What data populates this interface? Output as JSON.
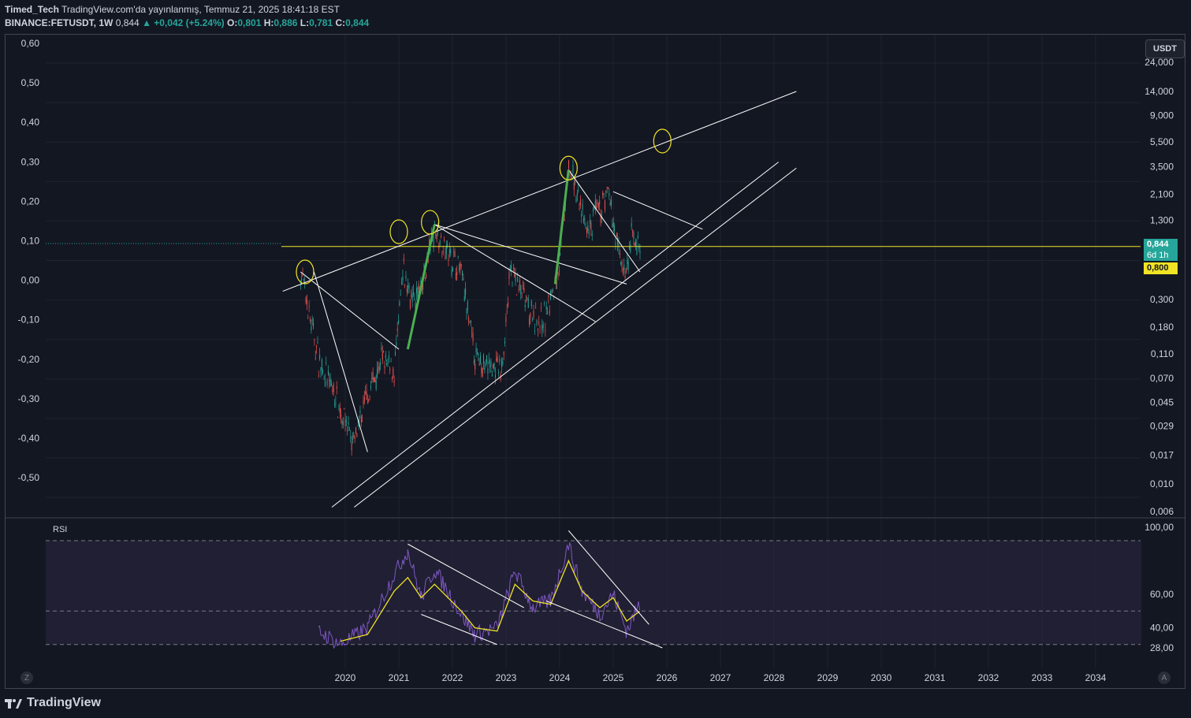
{
  "header": {
    "line1_author": "Timed_Tech",
    "line1_rest": "TradingView.com'da yayınlanmış, Temmuz 21, 2025 18:41:18 EST",
    "symbol": "BINANCE:FETUSDT, 1W",
    "last": "0,844",
    "change": "▲ +0,042 (+5.24%)",
    "o_label": "O:",
    "o_val": "0,801",
    "h_label": "H:",
    "h_val": "0,886",
    "l_label": "L:",
    "l_val": "0,781",
    "c_label": "C:",
    "c_val": "0,844"
  },
  "price_axis": {
    "currency": "USDT",
    "price_badge": "0,844",
    "countdown": "6d 1h",
    "level_badge": "0,800"
  },
  "rsi_label": "RSI",
  "corner_left": "Z",
  "corner_right": "A",
  "brand": "TradingView",
  "colors": {
    "up": "#26a69a",
    "down": "#ef5350",
    "background": "#131722",
    "drawing": "#ffffff",
    "highlight": "#f0e424",
    "green_leg": "#4caf50",
    "rsi_line": "#7e57c2",
    "rsi_ma": "#f0e424",
    "rsi_band": "#2a2540"
  },
  "chart_data": [
    {
      "type": "line",
      "scale": "log",
      "series": [
        {
          "x": [
            "2019-03",
            "2019-07",
            "2019-12",
            "2020-03",
            "2020-06",
            "2020-09",
            "2020-12",
            "2021-02",
            "2021-04",
            "2021-06",
            "2021-09",
            "2021-12",
            "2022-03",
            "2022-06",
            "2022-09",
            "2022-12",
            "2023-02",
            "2023-05",
            "2023-08",
            "2023-10",
            "2024-01",
            "2024-03",
            "2024-05",
            "2024-07",
            "2024-09",
            "2024-12",
            "2025-02",
            "2025-04",
            "2025-05",
            "2025-07"
          ],
          "y": [
            0.5,
            0.1,
            0.04,
            0.02,
            0.05,
            0.1,
            0.08,
            0.5,
            0.3,
            0.35,
            1.15,
            0.7,
            0.5,
            0.1,
            0.09,
            0.08,
            0.5,
            0.3,
            0.2,
            0.22,
            0.6,
            3.3,
            2.2,
            1.0,
            1.4,
            2.0,
            0.8,
            0.45,
            0.95,
            0.844
          ]
        }
      ],
      "y_ticks_left": [
        "0,60",
        "0,50",
        "0,40",
        "0,30",
        "0,20",
        "0,10",
        "0,00",
        "-0,10",
        "-0,20",
        "-0,30",
        "-0,40",
        "-0,50"
      ],
      "y_ticks_right": [
        "24,000",
        "14,000",
        "9,000",
        "5,500",
        "3,500",
        "2,100",
        "1,300",
        "0,300",
        "0,180",
        "0,110",
        "0,070",
        "0,045",
        "0,029",
        "0,017",
        "0,010",
        "0,006"
      ],
      "x_ticks": [
        "2020",
        "2021",
        "2022",
        "2023",
        "2024",
        "2025",
        "2026",
        "2027",
        "2028",
        "2029",
        "2030",
        "2031",
        "2032",
        "2033",
        "2034"
      ],
      "annotations": [
        "ascending channel",
        "upper resistance trendline",
        "descending triangles",
        "circled swing highs"
      ]
    },
    {
      "type": "line",
      "title": "RSI",
      "y_ticks": [
        "100,00",
        "60,00",
        "40,00",
        "28,00"
      ],
      "bands": [
        30,
        50,
        70
      ],
      "series": [
        {
          "name": "RSI",
          "x": [
            "2019-07",
            "2019-12",
            "2020-06",
            "2020-12",
            "2021-03",
            "2021-06",
            "2021-09",
            "2022-03",
            "2022-06",
            "2022-11",
            "2023-03",
            "2023-07",
            "2023-11",
            "2024-03",
            "2024-06",
            "2024-10",
            "2025-01",
            "2025-04",
            "2025-07"
          ],
          "values": [
            38,
            30,
            40,
            72,
            86,
            58,
            75,
            48,
            36,
            40,
            74,
            52,
            56,
            90,
            62,
            48,
            60,
            38,
            55
          ]
        },
        {
          "name": "MA",
          "x": [
            "2019-12",
            "2020-06",
            "2020-12",
            "2021-03",
            "2021-06",
            "2021-09",
            "2022-03",
            "2022-06",
            "2022-11",
            "2023-03",
            "2023-07",
            "2023-11",
            "2024-03",
            "2024-06",
            "2024-10",
            "2025-01",
            "2025-04",
            "2025-07"
          ],
          "values": [
            32,
            36,
            62,
            70,
            58,
            66,
            50,
            40,
            38,
            66,
            56,
            54,
            80,
            62,
            52,
            58,
            44,
            50
          ]
        }
      ]
    }
  ]
}
